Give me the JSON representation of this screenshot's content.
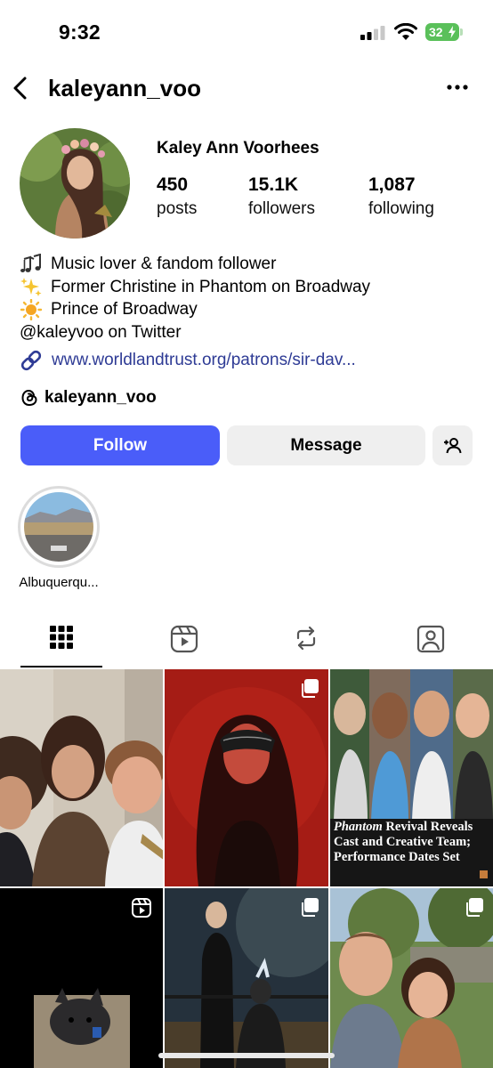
{
  "status_bar": {
    "time": "9:32",
    "battery": "32"
  },
  "header": {
    "username": "kaleyann_voo"
  },
  "profile": {
    "display_name": "Kaley Ann Voorhees",
    "stats": [
      {
        "count": "450",
        "label": "posts"
      },
      {
        "count": "15.1K",
        "label": "followers"
      },
      {
        "count": "1,087",
        "label": "following"
      }
    ],
    "bio": [
      {
        "emoji": "music-notes",
        "text": "Music lover & fandom follower"
      },
      {
        "emoji": "sparkles",
        "text": "Former Christine in Phantom on Broadway"
      },
      {
        "emoji": "sun",
        "text": "Prince of Broadway"
      },
      {
        "emoji": "",
        "text": "@kaleyvoo on Twitter"
      }
    ],
    "link": "www.worldlandtrust.org/patrons/sir-dav...",
    "threads_username": "kaleyann_voo"
  },
  "buttons": {
    "follow": "Follow",
    "message": "Message"
  },
  "highlights": [
    {
      "label": "Albuquerqu..."
    }
  ],
  "tabs": [
    "posts-grid",
    "reels",
    "reposts",
    "tagged"
  ],
  "posts": [
    {
      "type": "photo"
    },
    {
      "type": "carousel"
    },
    {
      "type": "carousel",
      "caption_italic": "Phantom",
      "caption": "Revival Reveals Cast and Creative Team; Performance Dates Set"
    },
    {
      "type": "reel"
    },
    {
      "type": "carousel"
    },
    {
      "type": "carousel"
    }
  ],
  "colors": {
    "follow_button": "#4a5df9",
    "link": "#2e3b95",
    "battery": "#5ac05a"
  }
}
